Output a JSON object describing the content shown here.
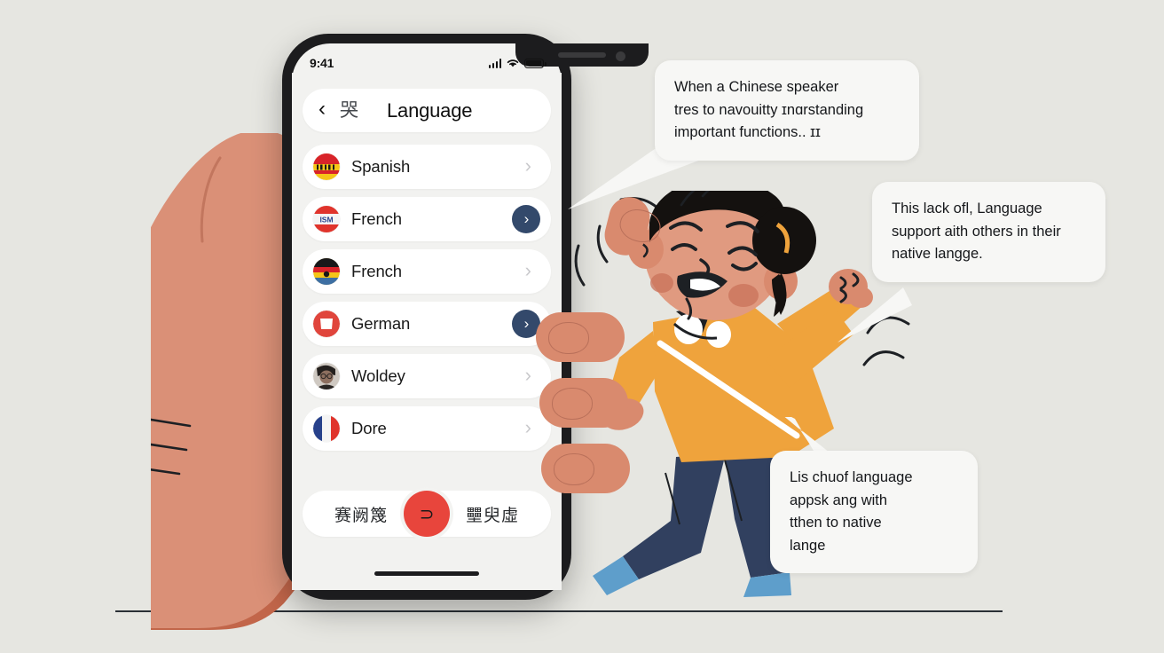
{
  "scene": {
    "background_color": "#e6e6e1",
    "ground_line_color": "#2b3036"
  },
  "phone": {
    "frame_color": "#1c1c1e",
    "screen_color": "#f2f2f0",
    "status_bar": {
      "clock": "9:41",
      "icons": [
        "cellular-bars-icon",
        "wifi-icon",
        "battery-icon"
      ]
    },
    "nav_bar": {
      "back_icon": "‹",
      "glyph": "哭",
      "title": "Language"
    },
    "language_list": [
      {
        "label": "Spanish",
        "flag": "spain-flag",
        "chevron": "plain",
        "chevron_glyph": "›"
      },
      {
        "label": "French",
        "flag": "austria-flag",
        "chevron": "filled",
        "chevron_glyph": "›"
      },
      {
        "label": "French",
        "flag": "germany-flag",
        "chevron": "plain",
        "chevron_glyph": "›"
      },
      {
        "label": "German",
        "flag": "red-square-flag",
        "chevron": "filled",
        "chevron_glyph": "›"
      },
      {
        "label": "Woldey",
        "flag": "avatar-photo",
        "chevron": "plain",
        "chevron_glyph": "›"
      },
      {
        "label": "Dore",
        "flag": "france-flag",
        "chevron": "plain",
        "chevron_glyph": "›"
      }
    ],
    "bottom_bar": {
      "left_text": "赛阙篾",
      "right_text": "壨臾虛",
      "fab_glyph": "⊃",
      "fab_color": "#e8453c"
    },
    "accent_button_color": "#33496b",
    "home_indicator": true
  },
  "bubbles": [
    {
      "name": "bubble-top",
      "lines": [
        "When a Chinese speaker",
        "tres to navouitty ɪnɑrstanding",
        "important functions.. ɪɪ"
      ]
    },
    {
      "name": "bubble-right",
      "lines": [
        "This lack ofl, Language",
        "support aith others in their",
        "native langge."
      ]
    },
    {
      "name": "bubble-bottom",
      "lines": [
        "Lis chuof language",
        "appsk ang with",
        "tthen to native",
        "lange"
      ]
    }
  ],
  "character": {
    "skin_color": "#e09a80",
    "hair_color": "#14110f",
    "shirt_color": "#efa33c",
    "pants_color": "#31405f",
    "shoe_color": "#5e9ecb",
    "expression": "frustrated-shouting"
  },
  "hand": {
    "thumb_color": "#da9077",
    "thumb_shadow_color": "#c2664a",
    "finger_color": "#d98a6e"
  }
}
